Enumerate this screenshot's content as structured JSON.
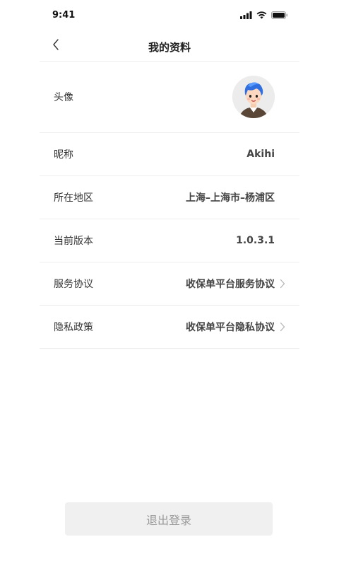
{
  "status_bar": {
    "time": "9:41",
    "icons": [
      "signal-icon",
      "wifi-icon",
      "battery-icon"
    ]
  },
  "nav": {
    "title": "我的资料",
    "back_icon": "chevron-left-icon"
  },
  "profile": {
    "avatar_label": "头像",
    "rows": [
      {
        "label": "昵称",
        "value": "Akihi"
      },
      {
        "label": "所在地区",
        "value": "上海–上海市–杨浦区"
      },
      {
        "label": "当前版本",
        "value": "1.0.3.1"
      },
      {
        "label": "服务协议",
        "value": "收保单平台服务协议"
      },
      {
        "label": "隐私政策",
        "value": "收保单平台隐私协议"
      }
    ]
  },
  "logout": {
    "label": "退出登录"
  },
  "colors": {
    "divider": "#eeeeee",
    "button_bg": "#f0f0f0",
    "button_text": "#9a9a9a",
    "avatar_hair": "#2f6fe0"
  }
}
